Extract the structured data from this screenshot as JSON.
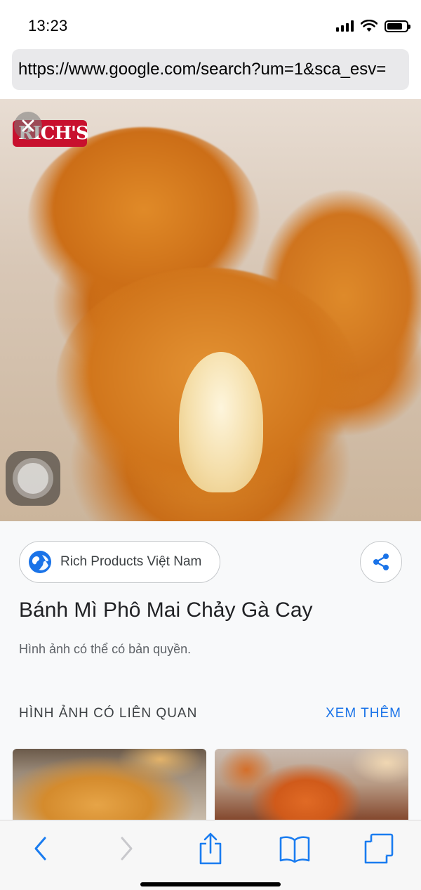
{
  "status_bar": {
    "time": "13:23",
    "icons": [
      "signal-icon",
      "wifi-icon",
      "battery-icon"
    ]
  },
  "browser": {
    "url": "https://www.google.com/search?um=1&sca_esv="
  },
  "image_viewer": {
    "logo_text": "RICH'S",
    "close_icon": "close-icon"
  },
  "details": {
    "source_name": "Rich Products Việt Nam",
    "title": "Bánh Mì Phô Mai Chảy Gà Cay",
    "copyright_note": "Hình ảnh có thể có bản quyền.",
    "related_heading": "HÌNH ẢNH CÓ LIÊN QUAN",
    "see_more": "XEM THÊM"
  },
  "toolbar": {
    "items": [
      "back-icon",
      "forward-icon",
      "share-icon",
      "bookmarks-icon",
      "tabs-icon"
    ]
  },
  "colors": {
    "accent": "#1a73e8",
    "toolbar_icon": "#1a7cf0",
    "disabled_icon": "#c8c8cc"
  }
}
